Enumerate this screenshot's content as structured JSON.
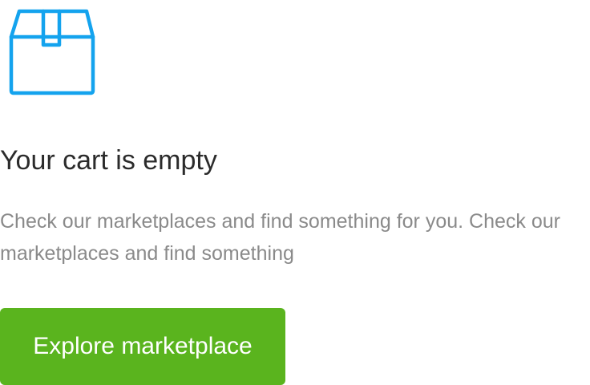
{
  "empty_cart": {
    "icon": "box-icon",
    "title": "Your cart is empty",
    "description": "Check our marketplaces and find something for you. Check our marketplaces and find something",
    "cta_label": "Explore marketplace"
  },
  "colors": {
    "icon": "#14a3ee",
    "cta_background": "#5ab41e",
    "cta_text": "#ffffff",
    "title": "#2b2b2b",
    "description": "#8a8a8a"
  }
}
